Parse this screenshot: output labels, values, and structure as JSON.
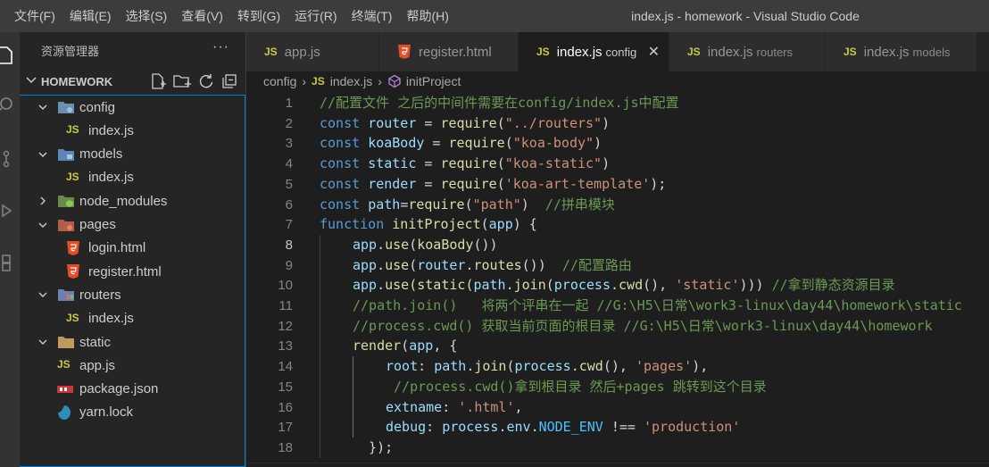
{
  "menu": [
    "文件(F)",
    "编辑(E)",
    "选择(S)",
    "查看(V)",
    "转到(G)",
    "运行(R)",
    "终端(T)",
    "帮助(H)"
  ],
  "window_title": "index.js - homework - Visual Studio Code",
  "sidebar": {
    "title": "资源管理器",
    "more": "···",
    "section": "HOMEWORK",
    "tree": [
      {
        "label": "config",
        "type": "folder",
        "depth": 0,
        "expanded": true,
        "icon": "config-folder-icon"
      },
      {
        "label": "index.js",
        "type": "js",
        "depth": 1
      },
      {
        "label": "models",
        "type": "folder",
        "depth": 0,
        "expanded": true,
        "icon": "models-folder-icon"
      },
      {
        "label": "index.js",
        "type": "js",
        "depth": 1
      },
      {
        "label": "node_modules",
        "type": "folder",
        "depth": 0,
        "expanded": false,
        "icon": "node-folder-icon"
      },
      {
        "label": "pages",
        "type": "folder",
        "depth": 0,
        "expanded": true,
        "icon": "pages-folder-icon"
      },
      {
        "label": "login.html",
        "type": "html",
        "depth": 1
      },
      {
        "label": "register.html",
        "type": "html",
        "depth": 1
      },
      {
        "label": "routers",
        "type": "folder",
        "depth": 0,
        "expanded": true,
        "icon": "routers-folder-icon"
      },
      {
        "label": "index.js",
        "type": "js",
        "depth": 1
      },
      {
        "label": "static",
        "type": "folder",
        "depth": 0,
        "expanded": true,
        "icon": "static-folder-icon"
      },
      {
        "label": "app.js",
        "type": "js",
        "depth": 0
      },
      {
        "label": "package.json",
        "type": "npm",
        "depth": 0
      },
      {
        "label": "yarn.lock",
        "type": "yarn",
        "depth": 0
      }
    ]
  },
  "tabs": [
    {
      "label": "app.js",
      "desc": "",
      "type": "js",
      "active": false
    },
    {
      "label": "register.html",
      "desc": "",
      "type": "html",
      "active": false
    },
    {
      "label": "index.js",
      "desc": "config",
      "type": "js",
      "active": true
    },
    {
      "label": "index.js",
      "desc": "routers",
      "type": "js",
      "active": false
    },
    {
      "label": "index.js",
      "desc": "models",
      "type": "js",
      "active": false
    }
  ],
  "js_badge": "JS",
  "close_glyph": "✕",
  "breadcrumb": {
    "folder": "config",
    "file": "index.js",
    "symbol": "initProject"
  },
  "current_line": 8,
  "code_lines": [
    {
      "n": 1,
      "indent": 0,
      "tokens": [
        [
          "cm",
          "//配置文件 之后的中间件需要在config/index.js中配置"
        ]
      ]
    },
    {
      "n": 2,
      "indent": 0,
      "tokens": [
        [
          "kw",
          "const"
        ],
        [
          "pl",
          " "
        ],
        [
          "vr",
          "router"
        ],
        [
          "pl",
          " = "
        ],
        [
          "fn",
          "require"
        ],
        [
          "pl",
          "("
        ],
        [
          "st",
          "\"../routers\""
        ],
        [
          "pl",
          ")"
        ]
      ]
    },
    {
      "n": 3,
      "indent": 0,
      "tokens": [
        [
          "kw",
          "const"
        ],
        [
          "pl",
          " "
        ],
        [
          "vr",
          "koaBody"
        ],
        [
          "pl",
          " = "
        ],
        [
          "fn",
          "require"
        ],
        [
          "pl",
          "("
        ],
        [
          "st",
          "\"koa-body\""
        ],
        [
          "pl",
          ")"
        ]
      ]
    },
    {
      "n": 4,
      "indent": 0,
      "tokens": [
        [
          "kw",
          "const"
        ],
        [
          "pl",
          " "
        ],
        [
          "vr",
          "static"
        ],
        [
          "pl",
          " = "
        ],
        [
          "fn",
          "require"
        ],
        [
          "pl",
          "("
        ],
        [
          "st",
          "\"koa-static\""
        ],
        [
          "pl",
          ")"
        ]
      ]
    },
    {
      "n": 5,
      "indent": 0,
      "tokens": [
        [
          "kw",
          "const"
        ],
        [
          "pl",
          " "
        ],
        [
          "vr",
          "render"
        ],
        [
          "pl",
          " = "
        ],
        [
          "fn",
          "require"
        ],
        [
          "pl",
          "("
        ],
        [
          "st",
          "'koa-art-template'"
        ],
        [
          "pl",
          ");"
        ]
      ]
    },
    {
      "n": 6,
      "indent": 0,
      "tokens": [
        [
          "kw",
          "const"
        ],
        [
          "pl",
          " "
        ],
        [
          "vr",
          "path"
        ],
        [
          "pl",
          "="
        ],
        [
          "fn",
          "require"
        ],
        [
          "pl",
          "("
        ],
        [
          "st",
          "\"path\""
        ],
        [
          "pl",
          ")  "
        ],
        [
          "cm",
          "//拼串模块"
        ]
      ]
    },
    {
      "n": 7,
      "indent": 0,
      "tokens": [
        [
          "kw",
          "function"
        ],
        [
          "pl",
          " "
        ],
        [
          "fn",
          "initProject"
        ],
        [
          "pl",
          "("
        ],
        [
          "vr",
          "app"
        ],
        [
          "pl",
          ") {"
        ]
      ]
    },
    {
      "n": 8,
      "indent": 1,
      "tokens": [
        [
          "vr",
          "app"
        ],
        [
          "pl",
          "."
        ],
        [
          "fn",
          "use"
        ],
        [
          "pl",
          "("
        ],
        [
          "fn",
          "koaBody"
        ],
        [
          "pl",
          "())"
        ]
      ]
    },
    {
      "n": 9,
      "indent": 1,
      "tokens": [
        [
          "vr",
          "app"
        ],
        [
          "pl",
          "."
        ],
        [
          "fn",
          "use"
        ],
        [
          "pl",
          "("
        ],
        [
          "vr",
          "router"
        ],
        [
          "pl",
          "."
        ],
        [
          "fn",
          "routes"
        ],
        [
          "pl",
          "())  "
        ],
        [
          "cm",
          "//配置路由"
        ]
      ]
    },
    {
      "n": 10,
      "indent": 1,
      "tokens": [
        [
          "vr",
          "app"
        ],
        [
          "pl",
          "."
        ],
        [
          "fn",
          "use"
        ],
        [
          "pl",
          "("
        ],
        [
          "fn",
          "static"
        ],
        [
          "pl",
          "("
        ],
        [
          "vr",
          "path"
        ],
        [
          "pl",
          "."
        ],
        [
          "fn",
          "join"
        ],
        [
          "pl",
          "("
        ],
        [
          "vr",
          "process"
        ],
        [
          "pl",
          "."
        ],
        [
          "fn",
          "cwd"
        ],
        [
          "pl",
          "(), "
        ],
        [
          "st",
          "'static'"
        ],
        [
          "pl",
          "))) "
        ],
        [
          "cm",
          "//拿到静态资源目录"
        ]
      ]
    },
    {
      "n": 11,
      "indent": 1,
      "tokens": [
        [
          "cm",
          "//path.join()   将两个评串在一起 //G:\\H5\\日常\\work3-linux\\day44\\homework\\static"
        ]
      ]
    },
    {
      "n": 12,
      "indent": 1,
      "tokens": [
        [
          "cm",
          "//process.cwd() 获取当前页面的根目录 //G:\\H5\\日常\\work3-linux\\day44\\homework"
        ]
      ]
    },
    {
      "n": 13,
      "indent": 1,
      "tokens": [
        [
          "fn",
          "render"
        ],
        [
          "pl",
          "("
        ],
        [
          "vr",
          "app"
        ],
        [
          "pl",
          ", {"
        ]
      ]
    },
    {
      "n": 14,
      "indent": 2,
      "tokens": [
        [
          "vr",
          "root"
        ],
        [
          "pl",
          ": "
        ],
        [
          "vr",
          "path"
        ],
        [
          "pl",
          "."
        ],
        [
          "fn",
          "join"
        ],
        [
          "pl",
          "("
        ],
        [
          "vr",
          "process"
        ],
        [
          "pl",
          "."
        ],
        [
          "fn",
          "cwd"
        ],
        [
          "pl",
          "(), "
        ],
        [
          "st",
          "'pages'"
        ],
        [
          "pl",
          "),"
        ]
      ]
    },
    {
      "n": 15,
      "indent": 2,
      "tokens": [
        [
          "cm",
          " //process.cwd()拿到根目录 然后+pages 跳转到这个目录"
        ]
      ]
    },
    {
      "n": 16,
      "indent": 2,
      "tokens": [
        [
          "vr",
          "extname"
        ],
        [
          "pl",
          ": "
        ],
        [
          "st",
          "'.html'"
        ],
        [
          "pl",
          ","
        ]
      ]
    },
    {
      "n": 17,
      "indent": 2,
      "tokens": [
        [
          "vr",
          "debug"
        ],
        [
          "pl",
          ": "
        ],
        [
          "vr",
          "process"
        ],
        [
          "pl",
          "."
        ],
        [
          "vr",
          "env"
        ],
        [
          "pl",
          "."
        ],
        [
          "cn",
          "NODE_ENV"
        ],
        [
          "pl",
          " !== "
        ],
        [
          "st",
          "'production'"
        ]
      ]
    },
    {
      "n": 18,
      "indent": 1,
      "tokens": [
        [
          "pl",
          "  });"
        ]
      ]
    }
  ],
  "colors": {
    "keyword": "#569cd6",
    "variable": "#9cdcfe",
    "function": "#dcdcaa",
    "string": "#ce9178",
    "comment": "#6a9955",
    "constant": "#4fc1ff",
    "focus_border": "#007fd4"
  }
}
